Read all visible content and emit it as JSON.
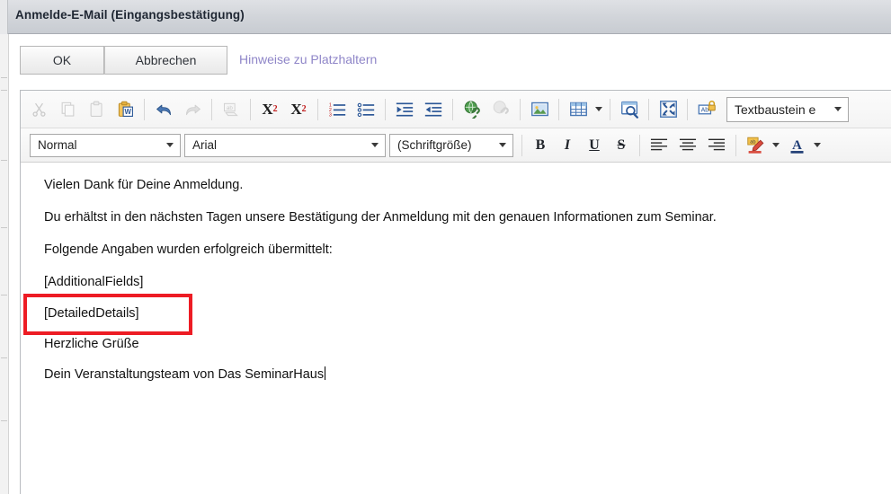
{
  "window": {
    "title": "Anmelde-E-Mail (Eingangsbestätigung)"
  },
  "actionbar": {
    "ok_label": "OK",
    "cancel_label": "Abbrechen",
    "hint_link_label": "Hinweise zu Platzhaltern",
    "hint_link_color": "#8f86c8"
  },
  "toolbar_row1": {
    "items": [
      {
        "name": "cut-icon",
        "title": "Ausschneiden",
        "disabled": true
      },
      {
        "name": "copy-icon",
        "title": "Kopieren",
        "disabled": true
      },
      {
        "name": "paste-icon",
        "title": "Einfügen",
        "disabled": true
      },
      {
        "name": "paste-from-word-icon",
        "title": "Aus Word einfügen",
        "disabled": false
      },
      {
        "name": "undo-icon",
        "title": "Rückgängig",
        "disabled": false
      },
      {
        "name": "redo-icon",
        "title": "Wiederholen",
        "disabled": true
      },
      {
        "name": "spellcheck-icon",
        "title": "Rechtschreibprüfung",
        "disabled": true
      },
      {
        "name": "superscript-icon",
        "title": "Hochgestellt",
        "disabled": false
      },
      {
        "name": "subscript-icon",
        "title": "Tiefgestellt",
        "disabled": false
      },
      {
        "name": "numbered-list-icon",
        "title": "Nummerierte Liste",
        "disabled": false
      },
      {
        "name": "bulleted-list-icon",
        "title": "Aufzählung",
        "disabled": false
      },
      {
        "name": "indent-increase-icon",
        "title": "Einzug vergrößern",
        "disabled": false
      },
      {
        "name": "indent-decrease-icon",
        "title": "Einzug verkleinern",
        "disabled": false
      },
      {
        "name": "insert-link-icon",
        "title": "Link einfügen",
        "disabled": false
      },
      {
        "name": "remove-link-icon",
        "title": "Link entfernen",
        "disabled": true
      },
      {
        "name": "insert-image-icon",
        "title": "Bild einfügen",
        "disabled": false
      },
      {
        "name": "insert-table-icon",
        "title": "Tabelle einfügen",
        "disabled": false
      },
      {
        "name": "table-options-caret-icon",
        "title": "Tabellenoptionen",
        "disabled": false
      },
      {
        "name": "source-view-icon",
        "title": "Quelltext anzeigen",
        "disabled": false
      },
      {
        "name": "fullscreen-icon",
        "title": "Vollbild",
        "disabled": false
      },
      {
        "name": "placeholder-lock-icon",
        "title": "Platzhalter",
        "disabled": false
      }
    ],
    "snippet_select": {
      "name": "textbaustein-select",
      "value": "Textbaustein e",
      "placeholder": "Textbaustein einfügen"
    }
  },
  "toolbar_row2": {
    "paragraph_select": {
      "name": "paragraph-format-select",
      "value": "Normal"
    },
    "font_select": {
      "name": "font-family-select",
      "value": "Arial"
    },
    "size_select": {
      "name": "font-size-select",
      "value": "(Schriftgröße)"
    },
    "bold_label": "B",
    "italic_label": "I",
    "underline_label": "U",
    "strike_label": "S",
    "items": [
      {
        "name": "align-left-icon",
        "title": "Linksbündig"
      },
      {
        "name": "align-center-icon",
        "title": "Zentriert"
      },
      {
        "name": "align-right-icon",
        "title": "Rechtsbündig"
      },
      {
        "name": "highlight-color-icon",
        "title": "Texthervorhebung"
      },
      {
        "name": "highlight-color-caret-icon",
        "title": "Farbauswahl"
      },
      {
        "name": "font-color-icon",
        "title": "Schriftfarbe"
      },
      {
        "name": "font-color-caret-icon",
        "title": "Farbauswahl"
      }
    ]
  },
  "document": {
    "paragraphs": [
      "Vielen Dank für Deine Anmeldung.",
      "Du erhältst in den nächsten Tagen unsere Bestätigung der Anmeldung mit den genauen Informationen zum Seminar.",
      "Folgende Angaben wurden erfolgreich übermittelt:",
      "[AdditionalFields]",
      "[DetailedDetails]",
      "Herzliche Grüße",
      "Dein Veranstaltungsteam von Das SeminarHaus"
    ]
  },
  "annotation": {
    "name": "highlight-box-detaileddetails",
    "color": "#ed1c24",
    "targets_text": "[DetailedDetails]"
  }
}
